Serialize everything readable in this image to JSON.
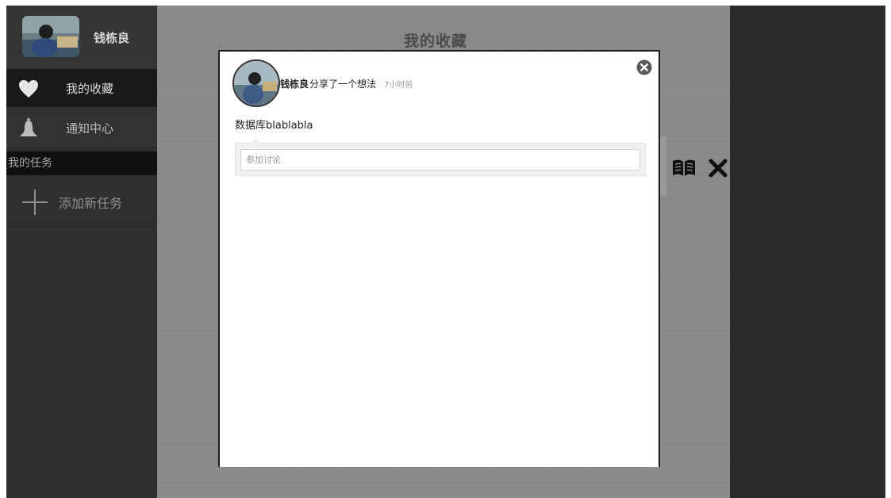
{
  "sidebar": {
    "profile_name": "钱栋良",
    "items": [
      {
        "label": "我的收藏",
        "icon": "heart-icon"
      },
      {
        "label": "通知中心",
        "icon": "bell-icon"
      }
    ],
    "section_header": "我的任务",
    "add_task_label": "添加新任务"
  },
  "main": {
    "title": "我的收藏"
  },
  "modal": {
    "author": "钱栋良",
    "action": "分享了一个想法",
    "time": "7小时前",
    "body": "数据库blablabla",
    "comment_placeholder": "参加讨论"
  },
  "icons": {
    "modal_close": "close-circle-icon",
    "book": "book-icon",
    "close": "close-x-icon",
    "add_task": "plus-icon"
  },
  "colors": {
    "sidebar_bg": "#2f2f2f",
    "active_item_bg": "#191919",
    "overlay_bg": "#8a8a8a",
    "modal_bg": "#ffffff"
  }
}
